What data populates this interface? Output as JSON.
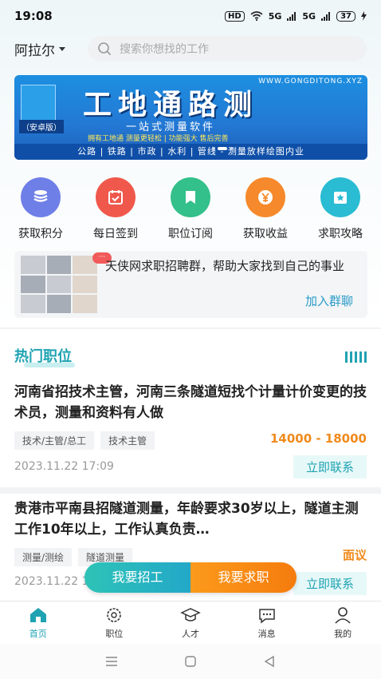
{
  "status": {
    "time": "19:08",
    "hd": "HD",
    "net1": "5G",
    "net2": "5G",
    "battery": "37"
  },
  "header": {
    "city": "阿拉尔",
    "search_placeholder": "搜索你想找的工作"
  },
  "banner": {
    "url": "WWW.GONGDITONG.XYZ",
    "edition": "（安卓版）",
    "title": "工地通路测",
    "subtitle": "一站式测量软件",
    "tagline": "拥有工地通 测量更轻松 | 功能强大 售后完善",
    "bottom": "公路 | 铁路 | 市政 | 水利 | 管线 - 测量放样绘图内业"
  },
  "quick": [
    {
      "label": "获取积分",
      "icon": "coins-icon",
      "color": "#6f7fe8"
    },
    {
      "label": "每日签到",
      "icon": "calendar-check-icon",
      "color": "#f0584c"
    },
    {
      "label": "职位订阅",
      "icon": "bookmark-icon",
      "color": "#33c08a"
    },
    {
      "label": "获取收益",
      "icon": "yen-coin-icon",
      "color": "#f6892b"
    },
    {
      "label": "求职攻略",
      "icon": "star-card-icon",
      "color": "#29bcd3"
    }
  ],
  "group": {
    "desc": "天侠网求职招聘群，帮助大家找到自己的事业",
    "join": "加入群聊",
    "bubble": "···"
  },
  "hot": {
    "title": "热门职位"
  },
  "jobs": [
    {
      "title": "河南省招技术主管，河南三条隧道短找个计量计价变更的技术员，测量和资料有人做",
      "tags": [
        "技术/主管/总工",
        "技术主管"
      ],
      "salary": "14000 - 18000",
      "date": "2023.11.22 17:09",
      "contact": "立即联系"
    },
    {
      "title": "贵港市平南县招隧道测量，年龄要求30岁以上，隧道主测工作10年以上，工作认真负责…",
      "tags": [
        "测量/测绘",
        "隧道测量"
      ],
      "salary": "面议",
      "date": "2023.11.22 1",
      "contact": "立即联系"
    }
  ],
  "fab": {
    "recruit": "我要招工",
    "seek": "我要求职"
  },
  "tabs": [
    {
      "label": "首页",
      "icon": "home-icon"
    },
    {
      "label": "职位",
      "icon": "gear-badge-icon"
    },
    {
      "label": "人才",
      "icon": "graduation-cap-icon"
    },
    {
      "label": "消息",
      "icon": "chat-bubble-icon"
    },
    {
      "label": "我的",
      "icon": "person-icon"
    }
  ],
  "colors": {
    "accent": "#1fa3b2",
    "salary": "#f08a1c"
  }
}
